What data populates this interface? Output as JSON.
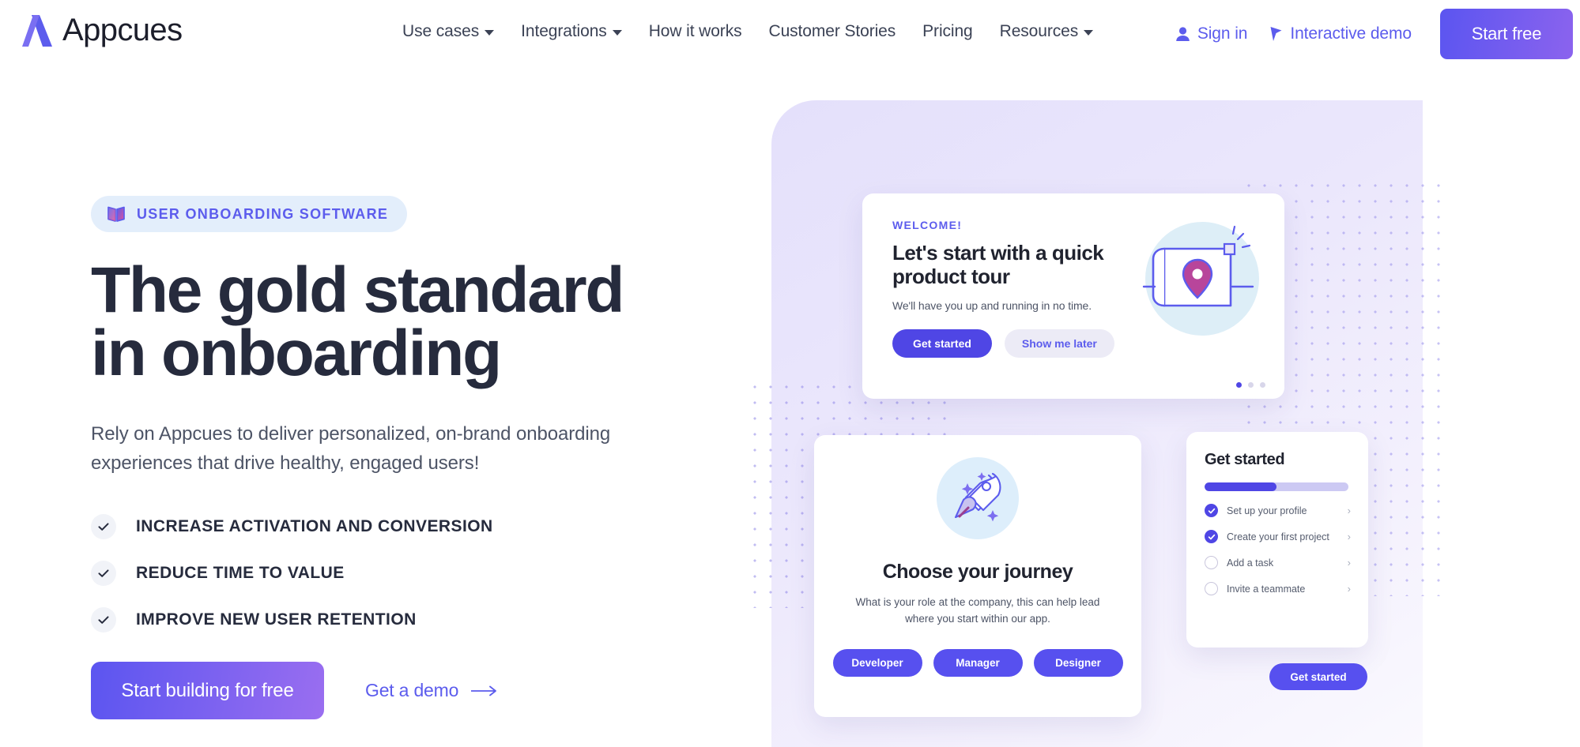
{
  "brand": {
    "name": "Appcues",
    "accent": "#5c5ced",
    "accent_dark": "#4f46e5",
    "ink": "#262b3d"
  },
  "header": {
    "nav_items": [
      {
        "label": "Use cases",
        "has_dropdown": true
      },
      {
        "label": "Integrations",
        "has_dropdown": true
      },
      {
        "label": "How it works",
        "has_dropdown": false
      },
      {
        "label": "Customer Stories",
        "has_dropdown": false
      },
      {
        "label": "Pricing",
        "has_dropdown": false
      },
      {
        "label": "Resources",
        "has_dropdown": true
      }
    ],
    "sign_in": {
      "label": "Sign in",
      "icon": "user-icon"
    },
    "interactive_demo": {
      "label": "Interactive demo",
      "icon": "cursor-pointer-icon"
    },
    "start_free": "Start free"
  },
  "hero": {
    "badge": {
      "label": "USER ONBOARDING SOFTWARE",
      "icon": "open-book-icon"
    },
    "title_line1": "The gold standard",
    "title_line2": "in onboarding",
    "subtitle": "Rely on Appcues to deliver personalized, on-brand onboarding experiences that drive healthy, engaged users!",
    "checklist": [
      "INCREASE ACTIVATION AND CONVERSION",
      "REDUCE TIME TO VALUE",
      "IMPROVE NEW USER RETENTION"
    ],
    "primary_cta": "Start building for free",
    "secondary_cta": "Get a demo"
  },
  "product": {
    "tour_card": {
      "eyebrow": "WELCOME!",
      "title": "Let's start with a quick product tour",
      "subtitle": "We'll have you up and running in no time.",
      "primary_button": "Get started",
      "secondary_button": "Show me later",
      "carousel_total": 3,
      "carousel_active": 1,
      "illustration": "map-with-location-pin-icon"
    },
    "journey_card": {
      "title": "Choose your journey",
      "subtitle": "What is your role at the company, this can help lead where you start within our app.",
      "options": [
        "Developer",
        "Manager",
        "Designer"
      ],
      "illustration": "rocket-icon"
    },
    "checklist_card": {
      "title": "Get started",
      "progress_percent": 50,
      "items": [
        {
          "label": "Set up your profile",
          "done": true
        },
        {
          "label": "Create your first project",
          "done": true
        },
        {
          "label": "Add a task",
          "done": false
        },
        {
          "label": "Invite a teammate",
          "done": false
        }
      ]
    },
    "floating_button": "Get started"
  }
}
